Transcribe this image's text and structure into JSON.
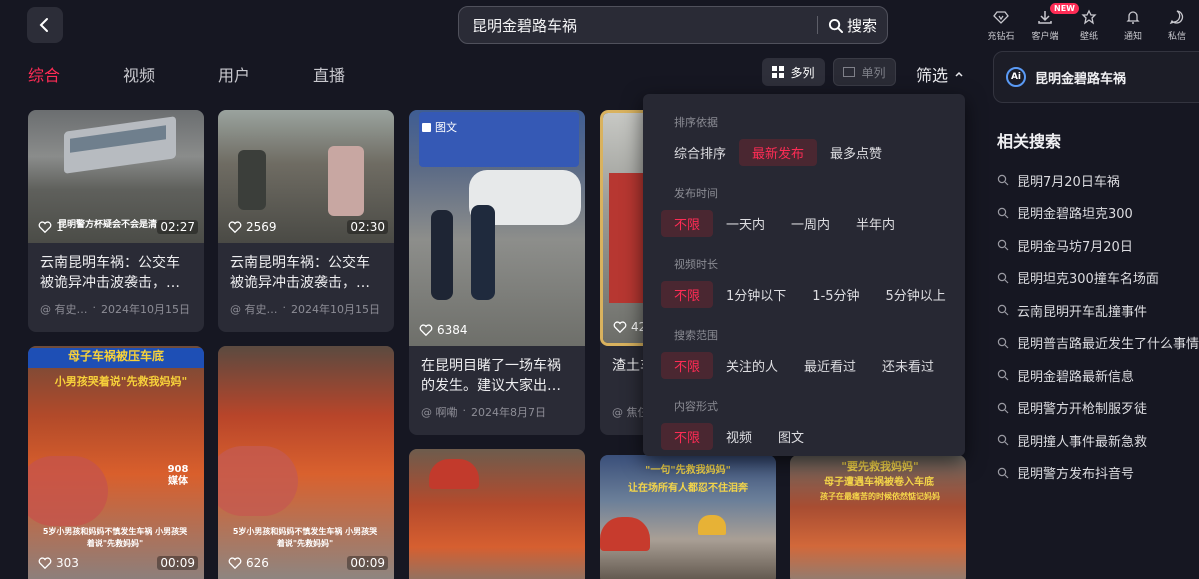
{
  "header": {
    "search_value": "昆明金碧路车祸",
    "search_button": "搜索",
    "actions": [
      {
        "icon": "diamond-icon",
        "label": "充钻石"
      },
      {
        "icon": "download-icon",
        "label": "客户端",
        "badge": "NEW"
      },
      {
        "icon": "wallpaper-icon",
        "label": "壁纸"
      },
      {
        "icon": "bell-icon",
        "label": "通知"
      },
      {
        "icon": "message-icon",
        "label": "私信"
      }
    ]
  },
  "tabs": [
    "综合",
    "视频",
    "用户",
    "直播"
  ],
  "view": {
    "multi": "多列",
    "single": "单列",
    "filter": "筛选"
  },
  "filter": {
    "sections": [
      {
        "label": "排序依据",
        "options": [
          "综合排序",
          "最新发布",
          "最多点赞"
        ],
        "active": 1
      },
      {
        "label": "发布时间",
        "options": [
          "不限",
          "一天内",
          "一周内",
          "半年内"
        ],
        "active": 0
      },
      {
        "label": "视频时长",
        "options": [
          "不限",
          "1分钟以下",
          "1-5分钟",
          "5分钟以上"
        ],
        "active": 0
      },
      {
        "label": "搜索范围",
        "options": [
          "不限",
          "关注的人",
          "最近看过",
          "还未看过"
        ],
        "active": 0
      },
      {
        "label": "内容形式",
        "options": [
          "不限",
          "视频",
          "图文"
        ],
        "active": 0
      }
    ]
  },
  "cards": [
    {
      "likes": "1",
      "duration": "02:27",
      "overlay": "昆明警方杯疑会不会是清",
      "title": "云南昆明车祸：公交车被诡异冲击波袭击，车上…",
      "author": "@ 有史…",
      "date": "2024年10月15日"
    },
    {
      "likes": "2569",
      "duration": "02:30",
      "title": "云南昆明车祸：公交车被诡异冲击波袭击，车上…",
      "author": "@ 有史…",
      "date": "2024年10月15日"
    },
    {
      "likes": "6384",
      "tag": "图文",
      "title": "在昆明目睹了一场车祸的发生。建议大家出门骑…",
      "author": "@ 啊嘞",
      "date": "2024年8月7日"
    },
    {
      "likes": "42",
      "title": "渣土车…速，无…",
      "author": "@ 焦仨"
    },
    {
      "likes": "303",
      "duration": "00:09",
      "banner": "母子车祸被压车底",
      "subbanner": "小男孩哭着说\"先救我妈妈\"",
      "caption": "5岁小男孩和妈妈不慎发生车祸 小男孩哭着说\"先救妈妈\"",
      "brand": "908 媒体"
    },
    {
      "likes": "626",
      "duration": "00:09",
      "caption": "5岁小男孩和妈妈不慎发生车祸 小男孩哭着说\"先救妈妈\""
    },
    {},
    {
      "banner": "\"一句\"先救我妈妈\"",
      "subbanner": "让在场所有人都忍不住泪奔"
    },
    {
      "banner": "\"要先救我妈妈\"",
      "subbanner": "母子遭遇车祸被卷入车底",
      "caption": "孩子在最痛苦的时候依然惦记妈妈"
    }
  ],
  "ai": {
    "label": "昆明金碧路车祸",
    "logo": "Ai"
  },
  "related": {
    "title": "相关搜索",
    "items": [
      "昆明7月20日车祸",
      "昆明金碧路坦克300",
      "昆明金马坊7月20日",
      "昆明坦克300撞车名场面",
      "云南昆明开车乱撞事件",
      "昆明普吉路最近发生了什么事情",
      "昆明金碧路最新信息",
      "昆明警方开枪制服歹徒",
      "昆明撞人事件最新急救",
      "昆明警方发布抖音号"
    ]
  },
  "colors": {
    "accent": "#fe2c55",
    "bg": "#161722",
    "card": "#2a2b36"
  }
}
